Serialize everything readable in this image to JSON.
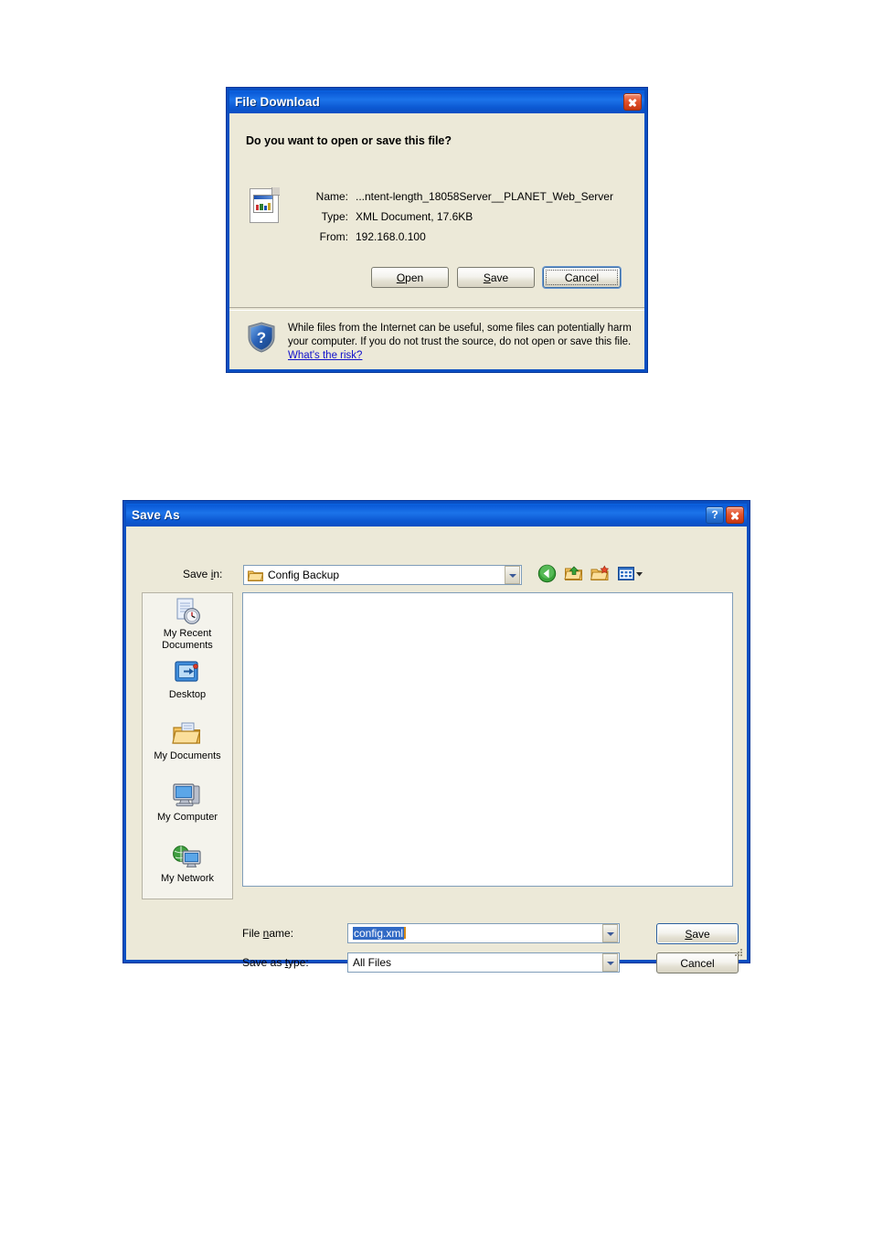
{
  "file_download": {
    "title": "File Download",
    "question": "Do you want to open or save this file?",
    "fields": [
      {
        "label": "Name:",
        "value": "...ntent-length_18058Server__PLANET_Web_Server"
      },
      {
        "label": "Type:",
        "value": "XML Document, 17.6KB"
      },
      {
        "label": "From:",
        "value": "192.168.0.100"
      }
    ],
    "buttons": {
      "open": "Open",
      "save": "Save",
      "cancel": "Cancel"
    },
    "warning": {
      "text": "While files from the Internet can be useful, some files can potentially harm your computer. If you do not trust the source, do not open or save this file.",
      "link": "What's the risk?",
      "icon": "shield-question-icon"
    },
    "file_icon": "xml-document-icon",
    "close_icon": "close-icon",
    "colors": {
      "titlebar": "#0a5ad8",
      "body": "#ece9d8",
      "link": "#1111cc",
      "close_button": "#e4542d"
    }
  },
  "save_as": {
    "title": "Save As",
    "save_in_label": "Save in:",
    "save_in_value": "Config Backup",
    "toolbar": [
      {
        "name": "back-icon",
        "tooltip": "Back"
      },
      {
        "name": "up-one-level-icon",
        "tooltip": "Up One Level"
      },
      {
        "name": "new-folder-icon",
        "tooltip": "Create New Folder"
      },
      {
        "name": "views-icon",
        "tooltip": "Views"
      }
    ],
    "places": [
      {
        "label": "My Recent Documents",
        "icon": "recent-documents-icon"
      },
      {
        "label": "Desktop",
        "icon": "desktop-icon"
      },
      {
        "label": "My Documents",
        "icon": "my-documents-icon"
      },
      {
        "label": "My Computer",
        "icon": "my-computer-icon"
      },
      {
        "label": "My Network",
        "icon": "my-network-icon"
      }
    ],
    "file_list_items": [],
    "file_name_label": "File name:",
    "file_name_value": "config.xml",
    "file_type_label": "Save as type:",
    "file_type_value": "All Files",
    "buttons": {
      "save": "Save",
      "cancel": "Cancel"
    },
    "help_icon": "help-icon",
    "close_icon": "close-icon",
    "colors": {
      "selection": "#316ac5",
      "caret": "#d78b18",
      "places_bg": "#f4f3ec"
    }
  }
}
